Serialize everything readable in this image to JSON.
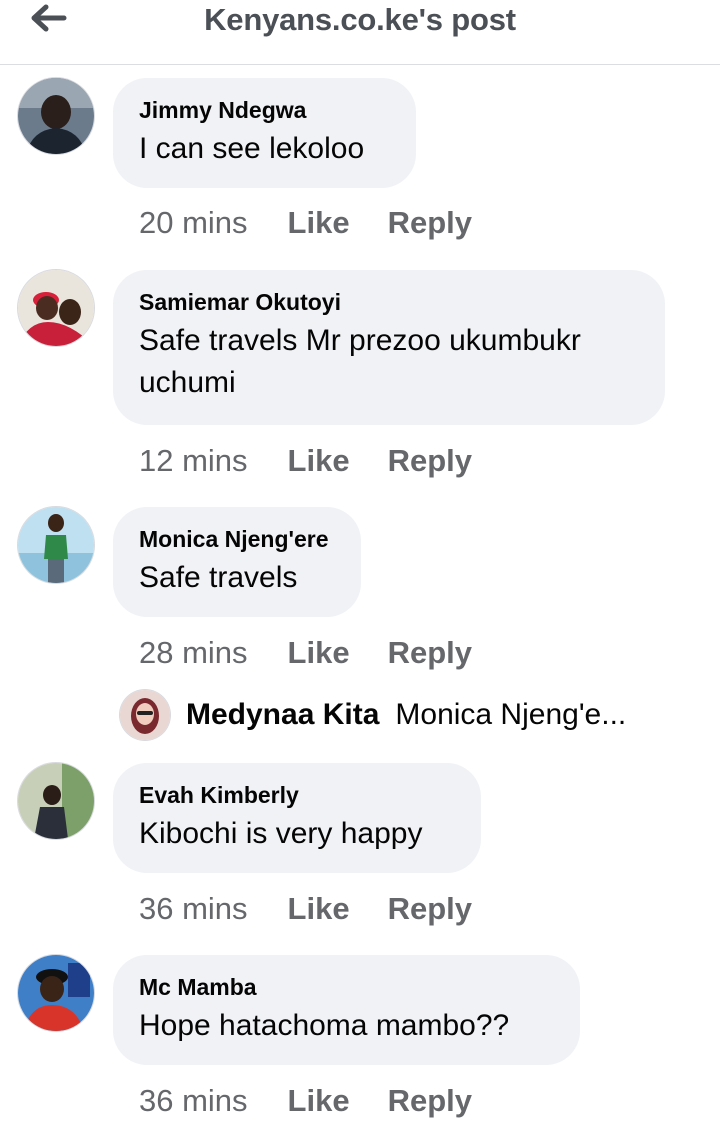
{
  "header": {
    "title": "Kenyans.co.ke's post",
    "back_icon": "arrow-left-icon"
  },
  "actions": {
    "like_label": "Like",
    "reply_label": "Reply"
  },
  "comments": [
    {
      "author": "Jimmy Ndegwa",
      "text": "I can see lekoloo",
      "time": "20 mins"
    },
    {
      "author": "Samiemar Okutoyi",
      "text": "Safe travels Mr prezoo ukumbukr uchumi",
      "time": "12 mins"
    },
    {
      "author": "Monica Njeng'ere",
      "text": "Safe travels",
      "time": "28 mins",
      "reply_preview": {
        "author": "Medynaa Kita",
        "text": "Monica Njeng'e..."
      }
    },
    {
      "author": "Evah Kimberly",
      "text": "Kibochi is very happy",
      "time": "36 mins"
    },
    {
      "author": "Mc Mamba",
      "text": "Hope hatachoma mambo??",
      "time": "36 mins"
    }
  ],
  "colors": {
    "bubble": "#f0f2f5",
    "secondary_text": "#65676b",
    "primary_text": "#050505",
    "divider": "#dadde1"
  }
}
